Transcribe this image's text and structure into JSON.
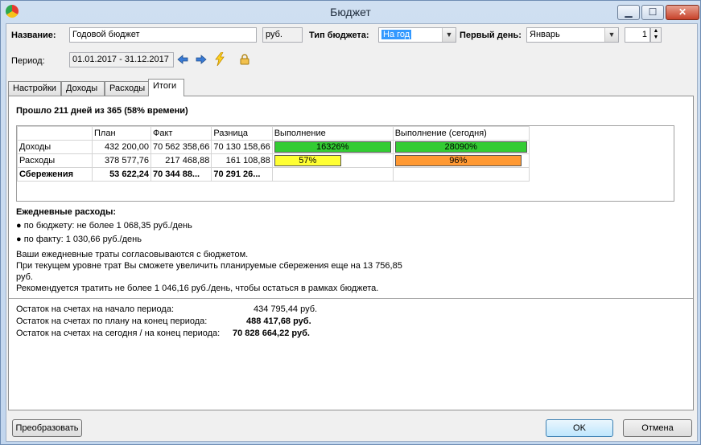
{
  "window": {
    "title": "Бюджет"
  },
  "form": {
    "name_label": "Название:",
    "name_value": "Годовой бюджет",
    "currency": "руб.",
    "type_label": "Тип бюджета:",
    "type_value": "На год",
    "first_day_label": "Первый день:",
    "first_day_month": "Январь",
    "first_day_number": "1",
    "period_label": "Период:",
    "period_value": "01.01.2017 - 31.12.2017"
  },
  "tabs": [
    "Настройки",
    "Доходы",
    "Расходы",
    "Итоги"
  ],
  "summary": {
    "elapsed": "Прошло 211 дней из 365 (58% времени)",
    "table": {
      "headers": [
        "",
        "План",
        "Факт",
        "Разница",
        "Выполнение",
        "Выполнение (сегодня)"
      ],
      "rows": [
        {
          "name": "Доходы",
          "plan": "432 200,00",
          "fact": "70 562 358,66",
          "diff": "70 130 158,66",
          "exec": "16326%",
          "exec_today": "28090%",
          "exec_fill": 1.0,
          "exec_color": "#33cc33",
          "today_fill": 1.0,
          "today_color": "#33cc33"
        },
        {
          "name": "Расходы",
          "plan": "378 577,76",
          "fact": "217 468,88",
          "diff": "161 108,88",
          "exec": "57%",
          "exec_today": "96%",
          "exec_fill": 0.57,
          "exec_color": "#ffff33",
          "today_fill": 0.96,
          "today_color": "#ff9933"
        },
        {
          "name": "Сбережения",
          "plan": "53 622,24",
          "fact": "70 344 88...",
          "diff": "70 291 26...",
          "exec": "",
          "exec_today": ""
        }
      ]
    },
    "daily_title": "Ежедневные расходы:",
    "daily_budget": "● по бюджету: не более 1 068,35 руб./день",
    "daily_fact": "● по факту: 1 030,66 руб./день",
    "note_1": "Ваши ежедневные траты согласовываются с бюджетом.",
    "note_2": "При текущем уровне трат Вы сможете увеличить планируемые сбережения еще на 13 756,85",
    "note_3": "руб.",
    "note_4": "Рекомендуется тратить не более 1 046,16 руб./день, чтобы остаться в рамках бюджета.",
    "balance_start_label": "Остаток на счетах на начало периода:",
    "balance_start_value": "434 795,44 руб.",
    "balance_plan_label": "Остаток на счетах по плану на конец периода:",
    "balance_plan_value": "488 417,68 руб.",
    "balance_today_label": "Остаток на счетах на сегодня / на конец периода:",
    "balance_today_value": "70 828 664,22 руб."
  },
  "buttons": {
    "convert": "Преобразовать",
    "ok": "OK",
    "cancel": "Отмена"
  }
}
